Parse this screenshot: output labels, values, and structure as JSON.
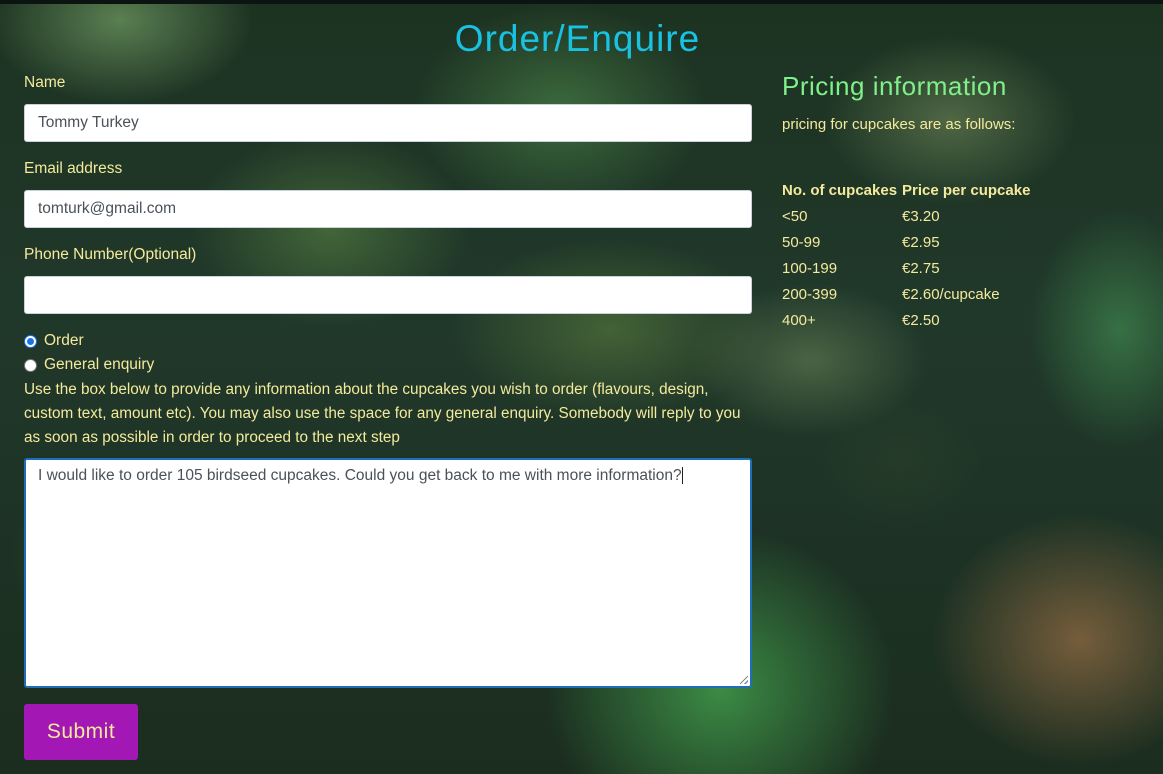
{
  "page": {
    "title": "Order/Enquire"
  },
  "form": {
    "name_label": "Name",
    "name_value": "Tommy Turkey",
    "email_label": "Email address",
    "email_value": "tomturk@gmail.com",
    "phone_label": "Phone Number(Optional)",
    "phone_value": "",
    "options": [
      {
        "label": "Order",
        "selected": true
      },
      {
        "label": "General enquiry",
        "selected": false
      }
    ],
    "help_text": "Use the box below to provide any information about the cupcakes you wish to order (flavours, design, custom text, amount etc). You may also use the space for any general enquiry. Somebody will reply to you as soon as possible in order to proceed to the next step",
    "message_value": "I would like to order 105 birdseed cupcakes. Could you get back to me with more information?",
    "submit_label": "Submit"
  },
  "pricing": {
    "title": "Pricing information",
    "intro": "pricing for cupcakes are as follows:",
    "headers": [
      "No. of cupcakes",
      "Price per cupcake"
    ],
    "rows": [
      [
        "<50",
        "€3.20"
      ],
      [
        "50-99",
        "€2.95"
      ],
      [
        "100-199",
        "€2.75"
      ],
      [
        "200-399",
        "€2.60/cupcake"
      ],
      [
        "400+",
        "€2.50"
      ]
    ]
  },
  "colors": {
    "title": "#19c1e2",
    "pricing_title": "#7ff08a",
    "text": "#f4ea9c",
    "button": "#a317b4",
    "radio_selected": "#1a73e8"
  }
}
